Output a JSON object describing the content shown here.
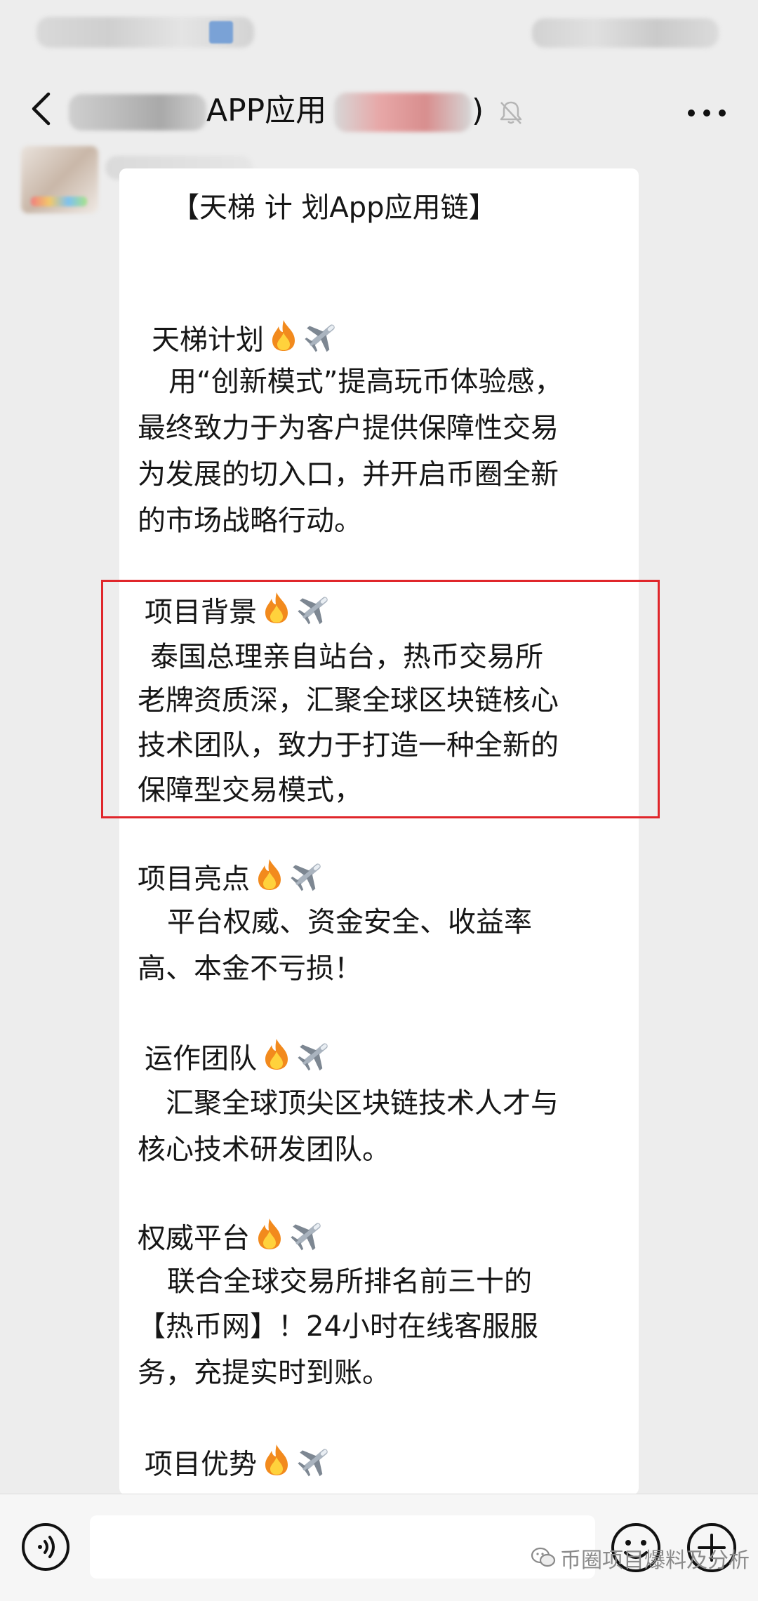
{
  "nav": {
    "title": "APP应用",
    "title_suffix": ")"
  },
  "message": {
    "lines": [
      "【天梯 计 划App应用链】",
      "天梯计划",
      "用“创新模式”提高玩币体验感，",
      "最终致力于为客户提供保障性交易",
      "为发展的切入口，并开启币圈全新",
      "的市场战略行动。",
      "项目背景",
      "泰国总理亲自站台，热币交易所",
      "老牌资质深，汇聚全球区块链核心",
      "技术团队，致力于打造一种全新的",
      "保障型交易模式，",
      "项目亮点",
      "平台权威、资金安全、收益率",
      "高、本金不亏损！",
      "运作团队",
      "汇聚全球顶尖区块链技术人才与",
      "核心技术研发团队。",
      "权威平台",
      "联合全球交易所排名前三十的",
      "【热币网】！24小时在线客服服",
      "务，充提实时到账。",
      "项目优势"
    ]
  },
  "icons": {
    "back": "chevron-left-icon",
    "mute": "bell-muted-icon",
    "more": "more-dots-icon",
    "fire": "fire-emoji-icon",
    "airplane": "airplane-emoji-icon",
    "voice": "voice-icon",
    "emoji": "smiley-icon",
    "plus": "plus-circle-icon"
  },
  "highlight_color": "#e0262b",
  "watermark": {
    "text": "币圈项目爆料及分析"
  }
}
